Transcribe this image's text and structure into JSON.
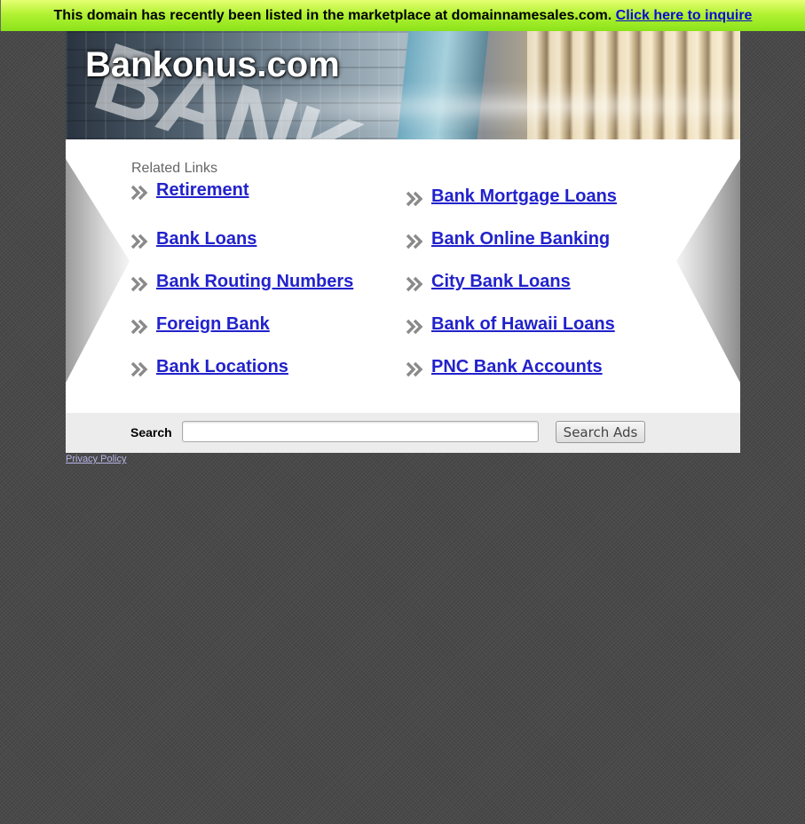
{
  "notice_bar": {
    "text": "This domain has recently been listed in the marketplace at domainnamesales.com.",
    "link_label": "Click here to inquire"
  },
  "header": {
    "site_title": "Bankonus.com"
  },
  "related": {
    "label": "Related Links",
    "left_links": [
      {
        "label": "Retirement"
      },
      {
        "label": "Bank Loans"
      },
      {
        "label": "Bank Routing Numbers"
      },
      {
        "label": "Foreign Bank"
      },
      {
        "label": "Bank Locations"
      }
    ],
    "right_links": [
      {
        "label": "Bank Mortgage Loans"
      },
      {
        "label": "Bank Online Banking"
      },
      {
        "label": "City Bank Loans"
      },
      {
        "label": "Bank of Hawaii Loans"
      },
      {
        "label": "PNC Bank Accounts"
      }
    ]
  },
  "search": {
    "label": "Search",
    "input_value": "",
    "button_label": "Search Ads"
  },
  "footer": {
    "privacy_label": "Privacy Policy"
  },
  "colors": {
    "link": "#2222cc",
    "notice_bar_green": "#8be31a",
    "background": "#4a4a4a"
  }
}
